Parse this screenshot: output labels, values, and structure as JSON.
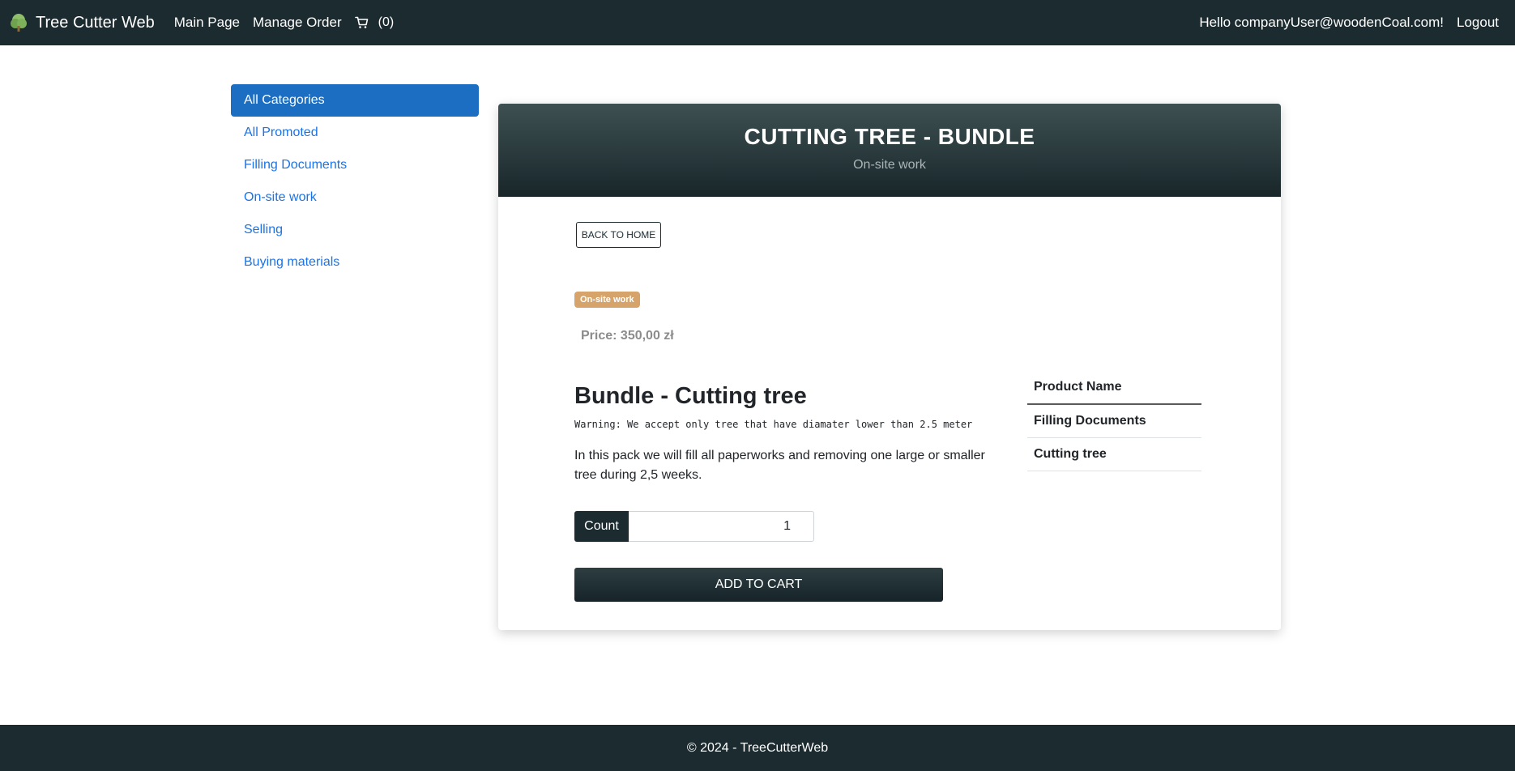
{
  "navbar": {
    "brand": "Tree Cutter Web",
    "brand_icon": "tree-icon",
    "links": [
      "Main Page",
      "Manage Order"
    ],
    "cart_icon": "cart-icon",
    "cart_count": "(0)",
    "greeting": "Hello companyUser@woodenCoal.com!",
    "logout": "Logout"
  },
  "sidebar": {
    "items": [
      {
        "label": "All Categories",
        "active": true
      },
      {
        "label": "All Promoted"
      },
      {
        "label": "Filling Documents"
      },
      {
        "label": "On-site work"
      },
      {
        "label": "Selling"
      },
      {
        "label": "Buying materials"
      }
    ]
  },
  "product": {
    "header_title": "CUTTING TREE - BUNDLE",
    "header_subtitle": "On-site work",
    "back_button": "BACK TO HOME",
    "badge": "On-site work",
    "price": "Price: 350,00 zł",
    "name": "Bundle - Cutting tree",
    "warning": "Warning: We accept only tree that have diamater lower than 2.5 meter",
    "description": "In this pack we will fill all paperworks and removing one large or smaller tree during 2,5 weeks.",
    "count_label": "Count",
    "count_value": "1",
    "add_to_cart": "ADD TO CART",
    "table": {
      "header": "Product Name",
      "rows": [
        "Filling Documents",
        "Cutting tree"
      ]
    }
  },
  "footer": {
    "text": "© 2024 - TreeCutterWeb"
  },
  "colors": {
    "navbar_bg": "#1c2b30",
    "accent_blue": "#1b6ec2",
    "link_blue": "#1a73e8",
    "badge": "#d6a46a"
  }
}
